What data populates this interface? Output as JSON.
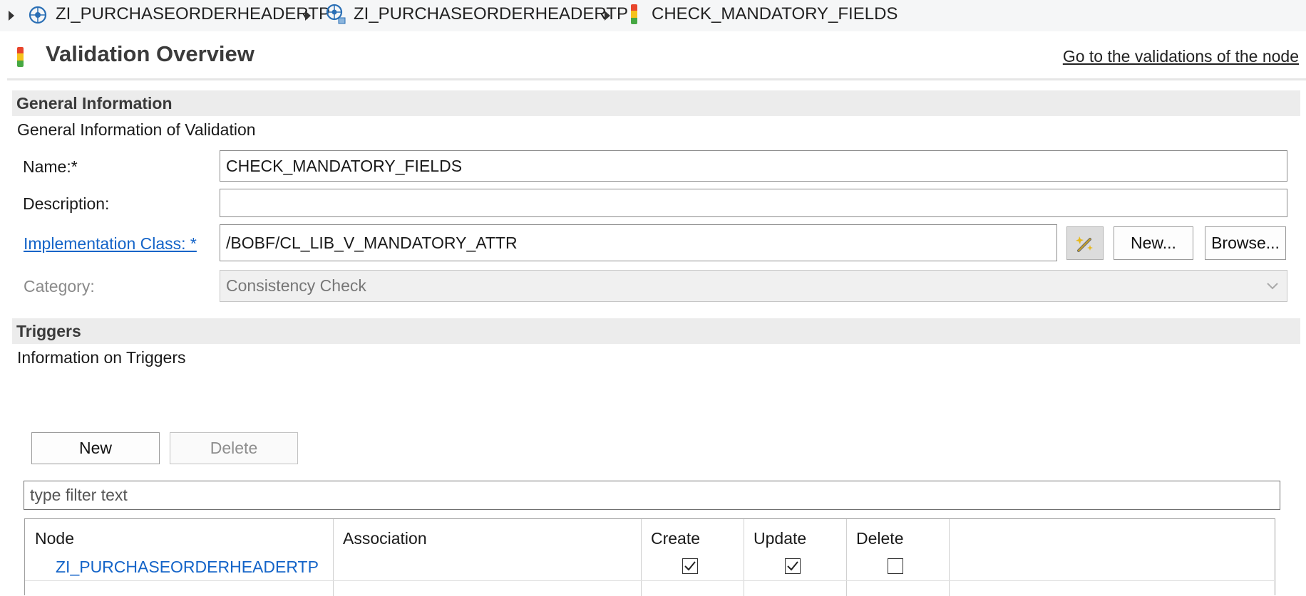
{
  "breadcrumb": [
    {
      "label": "ZI_PURCHASEORDERHEADERTP",
      "icon": "business-object-icon"
    },
    {
      "label": "ZI_PURCHASEORDERHEADERTP",
      "icon": "node-icon"
    },
    {
      "label": "CHECK_MANDATORY_FIELDS",
      "icon": "validation-icon"
    }
  ],
  "header": {
    "title": "Validation Overview",
    "goto_link": "Go to the validations of the node"
  },
  "general": {
    "section_title": "General Information",
    "section_desc": "General Information of Validation",
    "name_label": "Name:*",
    "name_value": "CHECK_MANDATORY_FIELDS",
    "description_label": "Description:",
    "description_value": "",
    "impl_label": "Implementation Class: *",
    "impl_value": "/BOBF/CL_LIB_V_MANDATORY_ATTR",
    "new_button": "New...",
    "browse_button": "Browse...",
    "category_label": "Category:",
    "category_value": "Consistency Check"
  },
  "triggers": {
    "section_title": "Triggers",
    "section_desc": "Information on Triggers",
    "new_button": "New",
    "delete_button": "Delete",
    "filter_placeholder": "type filter text",
    "columns": [
      "Node",
      "Association",
      "Create",
      "Update",
      "Delete"
    ],
    "rows": [
      {
        "node": "ZI_PURCHASEORDERHEADERTP",
        "association": "",
        "create": true,
        "update": true,
        "delete": false
      }
    ]
  },
  "colors": {
    "link": "#1464c8",
    "section_bg": "#ececec"
  }
}
